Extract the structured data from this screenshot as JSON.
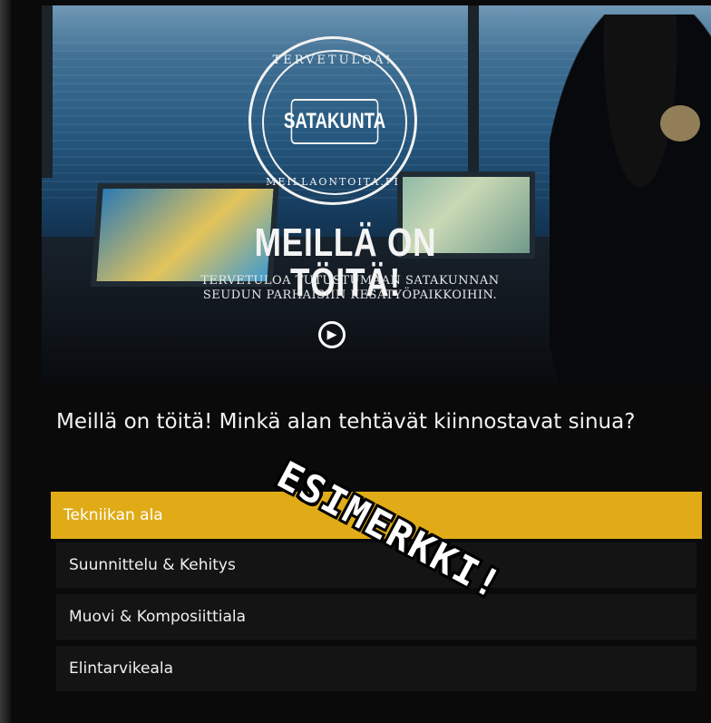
{
  "hero": {
    "stamp_top": "TERVETULOA!",
    "stamp_center": "SATAKUNTA",
    "stamp_bottom": "MEILLAONTOITA.FI",
    "title": "MEILLÄ ON TÖITÄ!",
    "subtitle_line1": "TERVETULOA TUTUSTUMAAN SATAKUNNAN",
    "subtitle_line2": "SEUDUN PARHAISIIN KESÄTYÖPAIKKOIHIN.",
    "play_icon": "play-icon"
  },
  "question": "Meillä on töitä! Minkä alan tehtävät kiinnostavat sinua?",
  "options": [
    {
      "label": "Tekniikan ala",
      "selected": true
    },
    {
      "label": "Suunnittelu & Kehitys",
      "selected": false
    },
    {
      "label": "Muovi & Komposiittiala",
      "selected": false
    },
    {
      "label": "Elintarvikeala",
      "selected": false
    }
  ],
  "watermark": "ESIMERKKI!",
  "colors": {
    "accent": "#e0ab17",
    "option_bg": "#141414",
    "page_bg": "#0a0a0a"
  }
}
